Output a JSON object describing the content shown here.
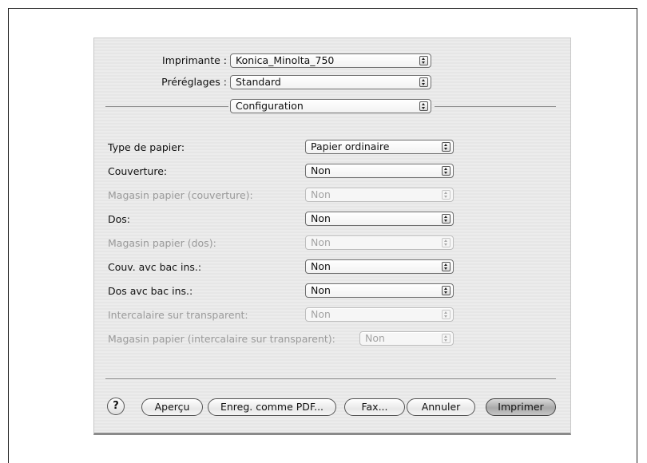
{
  "top": {
    "printer_label": "Imprimante :",
    "printer_value": "Konica_Minolta_750",
    "presets_label": "Préréglages :",
    "presets_value": "Standard",
    "panel_value": "Configuration"
  },
  "rows": [
    {
      "label": "Type de papier:",
      "value": "Papier ordinaire",
      "enabled": true
    },
    {
      "label": "Couverture:",
      "value": "Non",
      "enabled": true
    },
    {
      "label": "Magasin papier (couverture):",
      "value": "Non",
      "enabled": false
    },
    {
      "label": "Dos:",
      "value": "Non",
      "enabled": true
    },
    {
      "label": "Magasin papier (dos):",
      "value": "Non",
      "enabled": false
    },
    {
      "label": "Couv. avc bac ins.:",
      "value": "Non",
      "enabled": true
    },
    {
      "label": "Dos avc bac ins.:",
      "value": "Non",
      "enabled": true
    },
    {
      "label": "Intercalaire sur transparent:",
      "value": "Non",
      "enabled": false
    },
    {
      "label": "Magasin papier (intercalaire sur transparent):",
      "value": "Non",
      "enabled": false
    }
  ],
  "buttons": {
    "help": "?",
    "preview": "Aperçu",
    "save_pdf": "Enreg. comme PDF...",
    "fax": "Fax...",
    "cancel": "Annuler",
    "print": "Imprimer"
  }
}
